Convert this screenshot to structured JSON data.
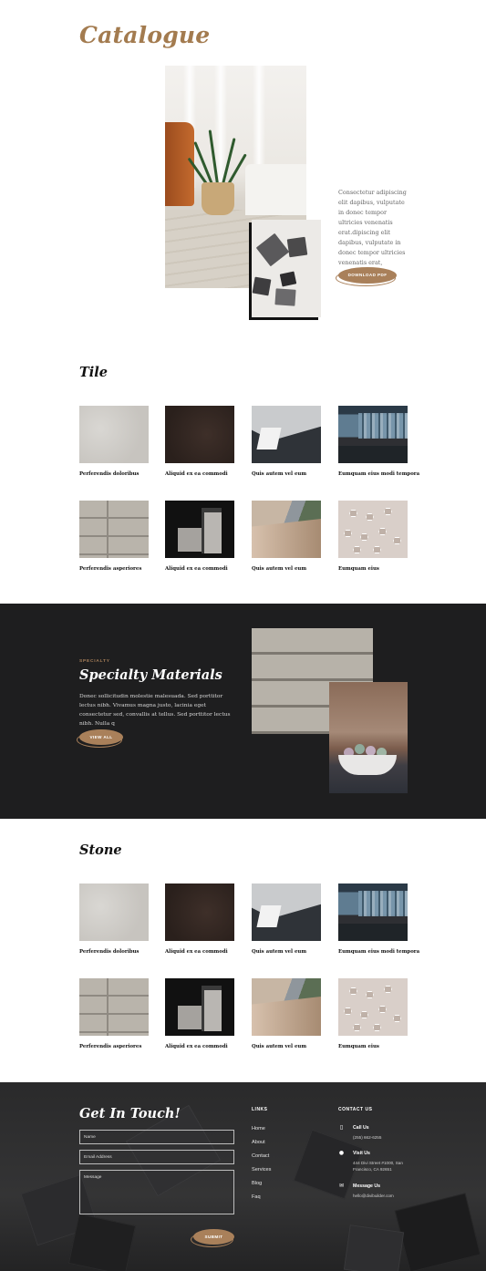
{
  "hero": {
    "title": "Catalogue",
    "description": "Consectetur adipiscing elit dapibus, vulputate in donec tempor ultricies venenatis erat.dipiscing elit dapibus, vulputate in donec tempor ultricies venenatis erat,",
    "download_label": "DOWNLOAD PDF"
  },
  "tile": {
    "title": "Tile",
    "items": [
      "Perferendis doloribus",
      "Aliquid ex ea commodi",
      "Quis autem vel eum",
      "Eumquam eius modi tempora",
      "Perferendis asperiores",
      "Aliquid ex ea commodi",
      "Quis autem vel eum",
      "Eumquam eius"
    ]
  },
  "specialty": {
    "kicker": "SPECIALTY",
    "title": "Specialty Materials",
    "text": "Donec sollicitudin molestie malesuada. Sed porttitor lectus nibh. Vivamus magna justo, lacinia eget consectetur sed, convallis at tellus. Sed porttitor lectus nibh. Nulla q",
    "button_label": "VIEW ALL"
  },
  "stone": {
    "title": "Stone",
    "items": [
      "Perferendis doloribus",
      "Aliquid ex ea commodi",
      "Quis autem vel eum",
      "Eumquam eius modi tempora",
      "Perferendis asperiores",
      "Aliquid ex ea commodi",
      "Quis autem vel eum",
      "Eumquam eius"
    ]
  },
  "footer": {
    "title": "Get In Touch!",
    "form": {
      "name_placeholder": "Name",
      "email_placeholder": "Email Address",
      "message_placeholder": "Message",
      "submit_label": "SUBMIT"
    },
    "links_heading": "LINKS",
    "links": [
      "Home",
      "About",
      "Contact",
      "Services",
      "Blog",
      "Faq"
    ],
    "contact_heading": "CONTACT US",
    "contact": {
      "call_heading": "Call Us",
      "phone": "(255) 662-6255",
      "visit_heading": "Visit Us",
      "address": "444 Divi Street #1000, San Francisco, CA 92651",
      "message_heading": "Message Us",
      "email": "hello@divibuilder.com"
    }
  },
  "colors": {
    "accent": "#a9805a",
    "dark_band": "#1e1e1f",
    "title_brown": "#a37b4f"
  },
  "icons": [
    "phone-icon",
    "map-pin-icon",
    "envelope-icon"
  ]
}
